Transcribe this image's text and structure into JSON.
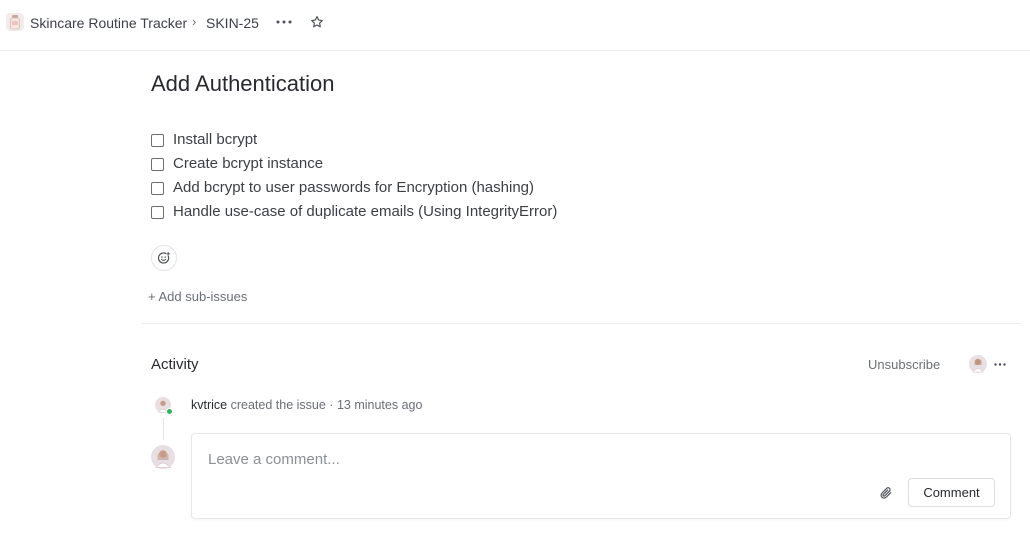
{
  "header": {
    "project_name": "Skincare Routine Tracker",
    "separator": "›",
    "issue_id": "SKIN-25",
    "more_icon": "ellipsis-icon",
    "star_icon": "star-icon"
  },
  "issue": {
    "title": "Add Authentication",
    "checklist": [
      {
        "label": "Install bcrypt",
        "checked": false
      },
      {
        "label": "Create bcrypt instance",
        "checked": false
      },
      {
        "label": "Add bcrypt to user passwords for Encryption (hashing)",
        "checked": false
      },
      {
        "label": "Handle use-case of duplicate emails (Using IntegrityError)",
        "checked": false
      }
    ],
    "reaction_icon": "emoji-reaction-icon",
    "add_sub_issues_label": "+ Add sub-issues"
  },
  "activity": {
    "title": "Activity",
    "unsubscribe_label": "Unsubscribe",
    "events": [
      {
        "user": "kvtrice",
        "action": "created the issue",
        "separator": "·",
        "time": "13 minutes ago"
      }
    ],
    "comment": {
      "placeholder": "Leave a comment...",
      "value": "",
      "attach_icon": "paperclip-icon",
      "submit_label": "Comment"
    }
  },
  "colors": {
    "online": "#2db35a",
    "text": "#282a30",
    "muted": "#6b6f76",
    "border": "#ececee"
  }
}
